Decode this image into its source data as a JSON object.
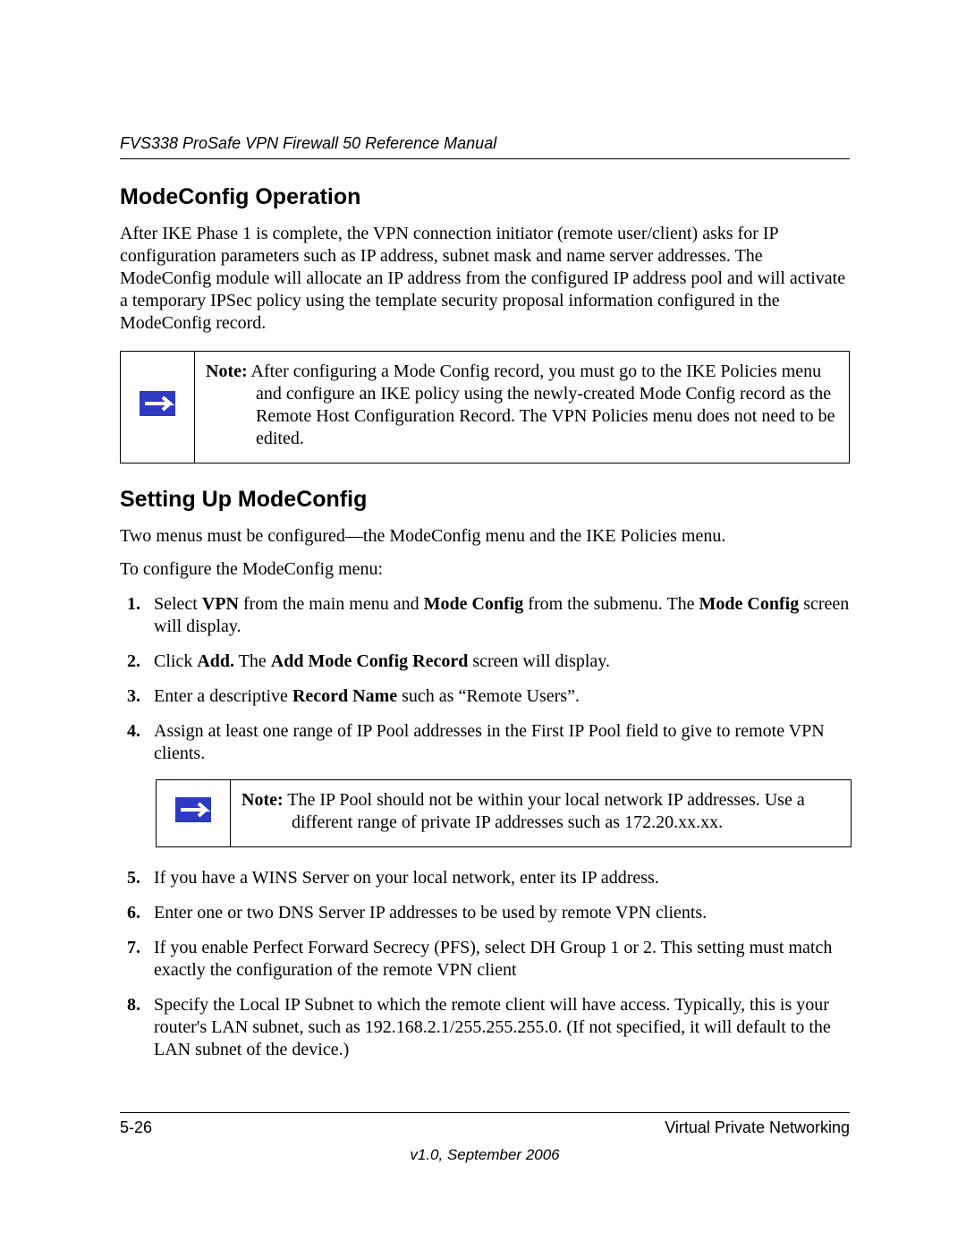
{
  "header": {
    "running": "FVS338 ProSafe VPN Firewall 50 Reference Manual"
  },
  "section1": {
    "heading": "ModeConfig Operation",
    "para": "After IKE Phase 1 is complete, the VPN connection initiator (remote user/client) asks for IP configuration parameters such as IP address, subnet mask and name server addresses. The ModeConfig module will allocate an IP address from the configured IP address pool and will activate a temporary IPSec policy using the template security proposal information configured in the ModeConfig record."
  },
  "note1": {
    "label": "Note:",
    "line1": " After configuring a Mode Config record, you must go to the IKE Policies menu",
    "rest": "and configure an IKE policy using the newly-created Mode Config record as the Remote Host Configuration Record. The VPN Policies menu does not need to be edited."
  },
  "section2": {
    "heading": "Setting Up ModeConfig",
    "intro1": "Two menus must be configured—the ModeConfig menu and the IKE Policies menu.",
    "intro2": "To configure the ModeConfig menu:"
  },
  "steps_a": {
    "s1": {
      "pre": "Select ",
      "b1": "VPN",
      "mid1": " from the main menu and ",
      "b2": "Mode Config",
      "mid2": " from the submenu. The ",
      "b3": "Mode Config",
      "post": " screen will display."
    },
    "s2": {
      "pre": "Click ",
      "b1": "Add.",
      "mid": " The ",
      "b2": "Add Mode Config Record",
      "post": " screen will display."
    },
    "s3": {
      "pre": "Enter a descriptive ",
      "b1": "Record Name",
      "post": " such as “Remote Users”."
    },
    "s4": "Assign at least one range of IP Pool addresses in the First IP Pool field to give to remote VPN clients."
  },
  "note2": {
    "label": "Note:",
    "line1": " The IP Pool should not be within your local network IP addresses. Use a",
    "rest": "different range of private IP addresses such as 172.20.xx.xx."
  },
  "steps_b": {
    "s5": "If you have a WINS Server on your local network, enter its IP address.",
    "s6": "Enter one or two DNS Server IP addresses to be used by remote VPN clients.",
    "s7": "If you enable Perfect Forward Secrecy (PFS), select DH Group 1 or 2. This setting must match exactly the configuration of the remote VPN client",
    "s8": "Specify the Local IP Subnet to which the remote client will have access. Typically, this is your router's LAN subnet, such as 192.168.2.1/255.255.255.0. (If not specified, it will default to the LAN subnet of the device.)"
  },
  "footer": {
    "left": "5-26",
    "right": "Virtual Private Networking",
    "version": "v1.0, September 2006"
  }
}
